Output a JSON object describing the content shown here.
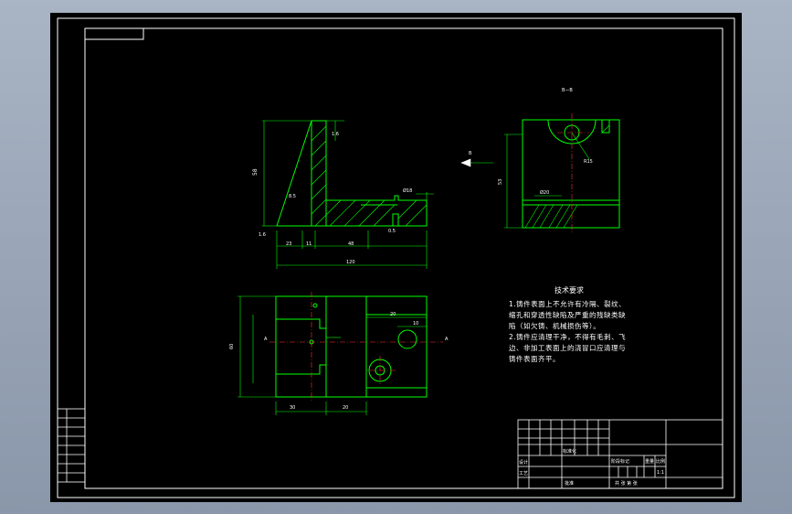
{
  "drawing": {
    "background_color": "#000000",
    "frame_color": "#ffffff",
    "outline_color": "#00ff00",
    "dimension_color": "#00ff00",
    "centerline_color": "#ff3030",
    "hatch_color": "#00ff00"
  },
  "views": {
    "front_dims": {
      "height": "58",
      "top_right": "1.6",
      "side_small": "8.5",
      "bottom_a": "23",
      "bottom_b": "11",
      "bottom_c": "48",
      "total": "120",
      "right_dim": "Ø18",
      "right_small": "0.5",
      "left_small": "1.6"
    },
    "side_view_label": "B—B",
    "side_dims": {
      "height": "53",
      "radius": "R15",
      "bottom_width": "Ø20",
      "arrow_label": "B"
    },
    "top_dims": {
      "overall_height": "60",
      "width_a": "30",
      "width_b": "20",
      "hole_width": "20",
      "hole_right": "10",
      "section_left": "A",
      "section_right": "A"
    }
  },
  "tech_notes": {
    "title": "技术要求",
    "lines": [
      "1.铸件表面上不允许有冷隔、裂纹、",
      "缩孔和穿透性缺陷及严重的残缺类缺",
      "陷（如欠铸、机械损伤等）。",
      "2.铸件应清理干净，不得有毛刺、飞",
      "边、非加工表面上的浇冒口应清理与",
      "铸件表面齐平。"
    ]
  },
  "title_block": {
    "design_label": "设计",
    "process_label": "工艺",
    "std_label": "标准化",
    "approve_label": "批准",
    "stage_label": "阶段标记",
    "weight_label": "重量",
    "scale_label": "比例",
    "scale_value": "1:1",
    "sheet_label": "共  张  第  张"
  }
}
